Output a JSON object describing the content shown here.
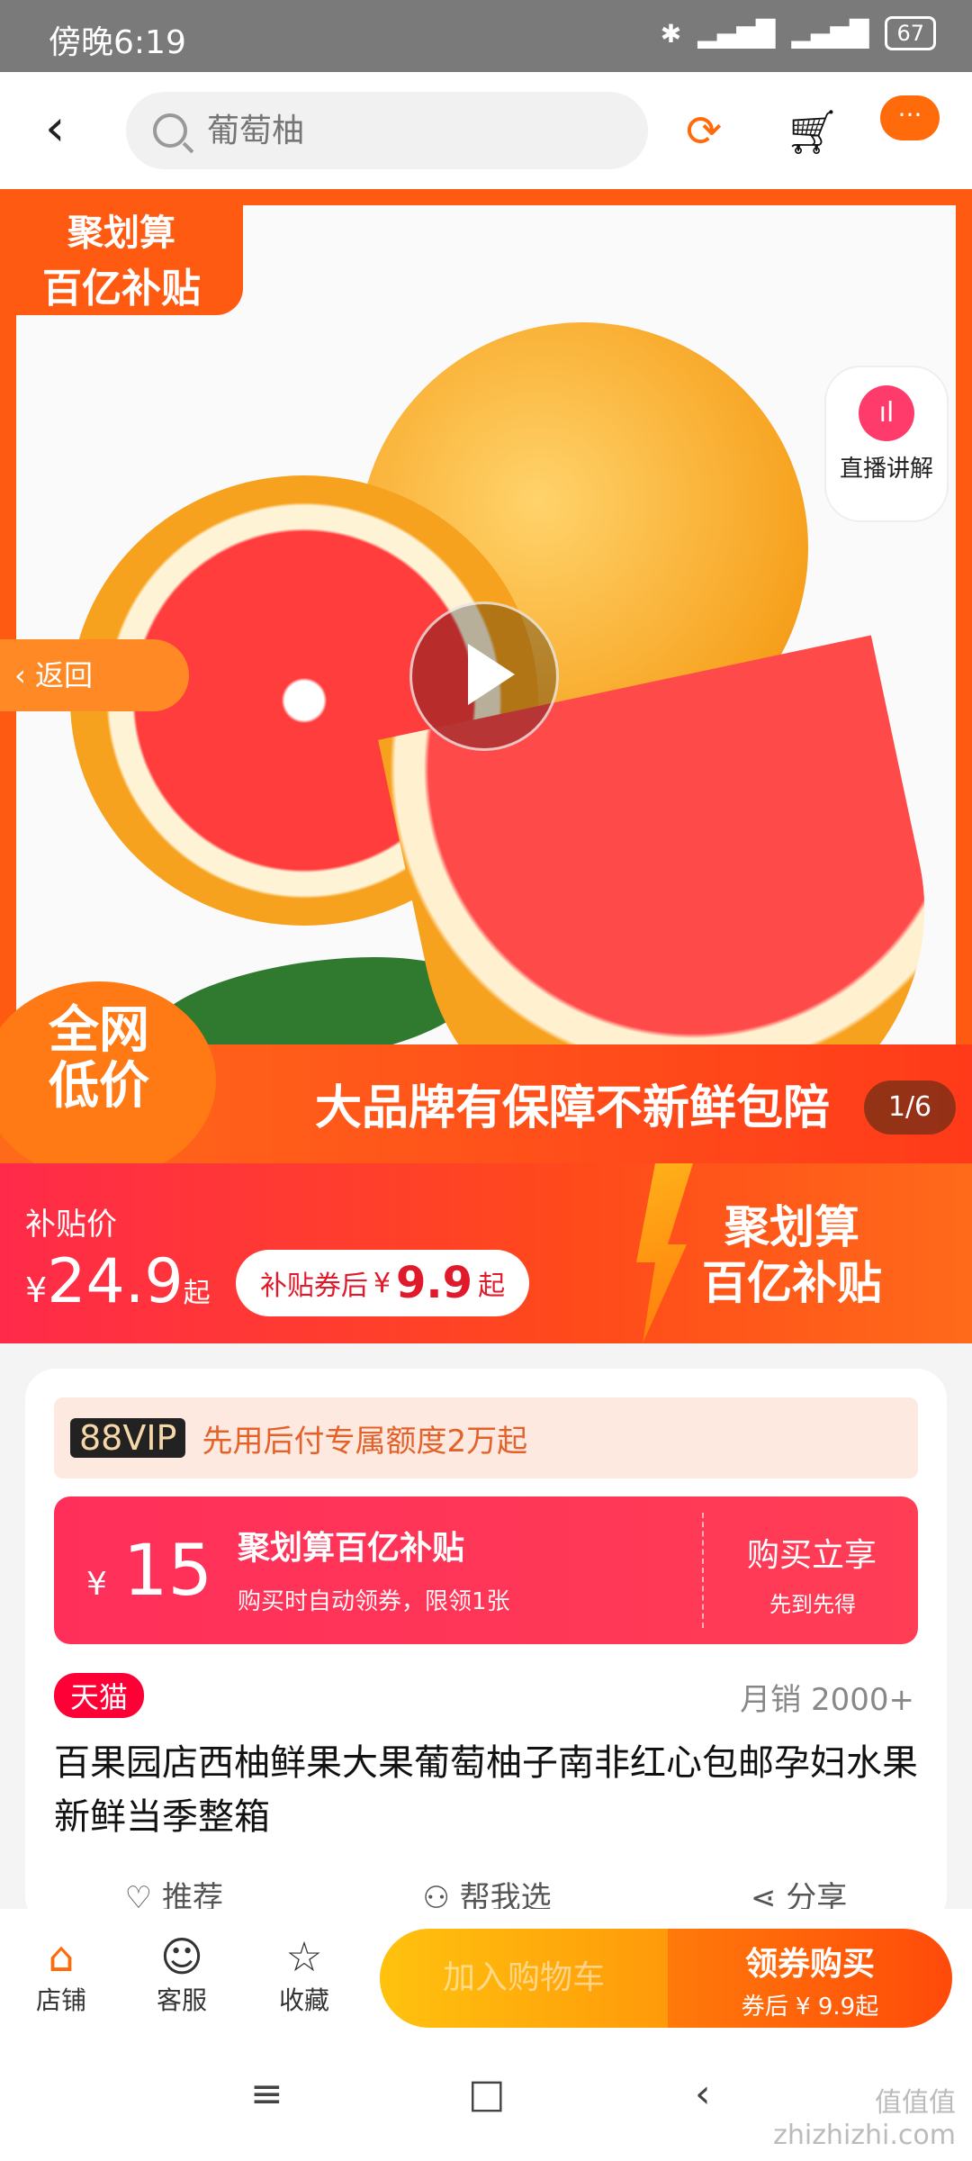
{
  "status": {
    "time": "傍晚6:19",
    "battery": "67"
  },
  "nav": {
    "search_placeholder": "葡萄柚"
  },
  "hero": {
    "badge_line1": "聚划算",
    "badge_line2": "百亿补贴",
    "live_label": "直播讲解",
    "return_label": "返回",
    "low_price": "全网\n低价",
    "slogan": "大品牌有保障不新鲜包陪",
    "counter": "1/6"
  },
  "subsidy": {
    "label": "补贴价",
    "currency": "¥",
    "price": "24.9",
    "qi": "起",
    "coupon_prefix": "补贴券后",
    "coupon_currency": "¥",
    "coupon_amount": "9.9",
    "coupon_qi": "起",
    "brand_line1": "聚划算",
    "brand_line2": "百亿补贴"
  },
  "card": {
    "vip_tag": "88VIP",
    "vip_text": "先用后付专属额度2万起",
    "coupon": {
      "currency": "¥",
      "amount": "15",
      "title": "聚划算百亿补贴",
      "desc": "购买时自动领券，限领1张",
      "action": "购买立享",
      "action_sub": "先到先得"
    },
    "tmall": "天猫",
    "sales": "月销 2000+",
    "title": "百果园店西柚鲜果大果葡萄柚子南非红心包邮孕妇水果新鲜当季整箱",
    "actions": [
      "推荐",
      "帮我选",
      "分享"
    ]
  },
  "bottom": {
    "shop": "店铺",
    "service": "客服",
    "favorite": "收藏",
    "add_cart": "加入购物车",
    "buy_label": "领券购买",
    "buy_sub": "券后 ¥ 9.9起"
  },
  "watermark": "值值值\nzhizhizhi.com"
}
